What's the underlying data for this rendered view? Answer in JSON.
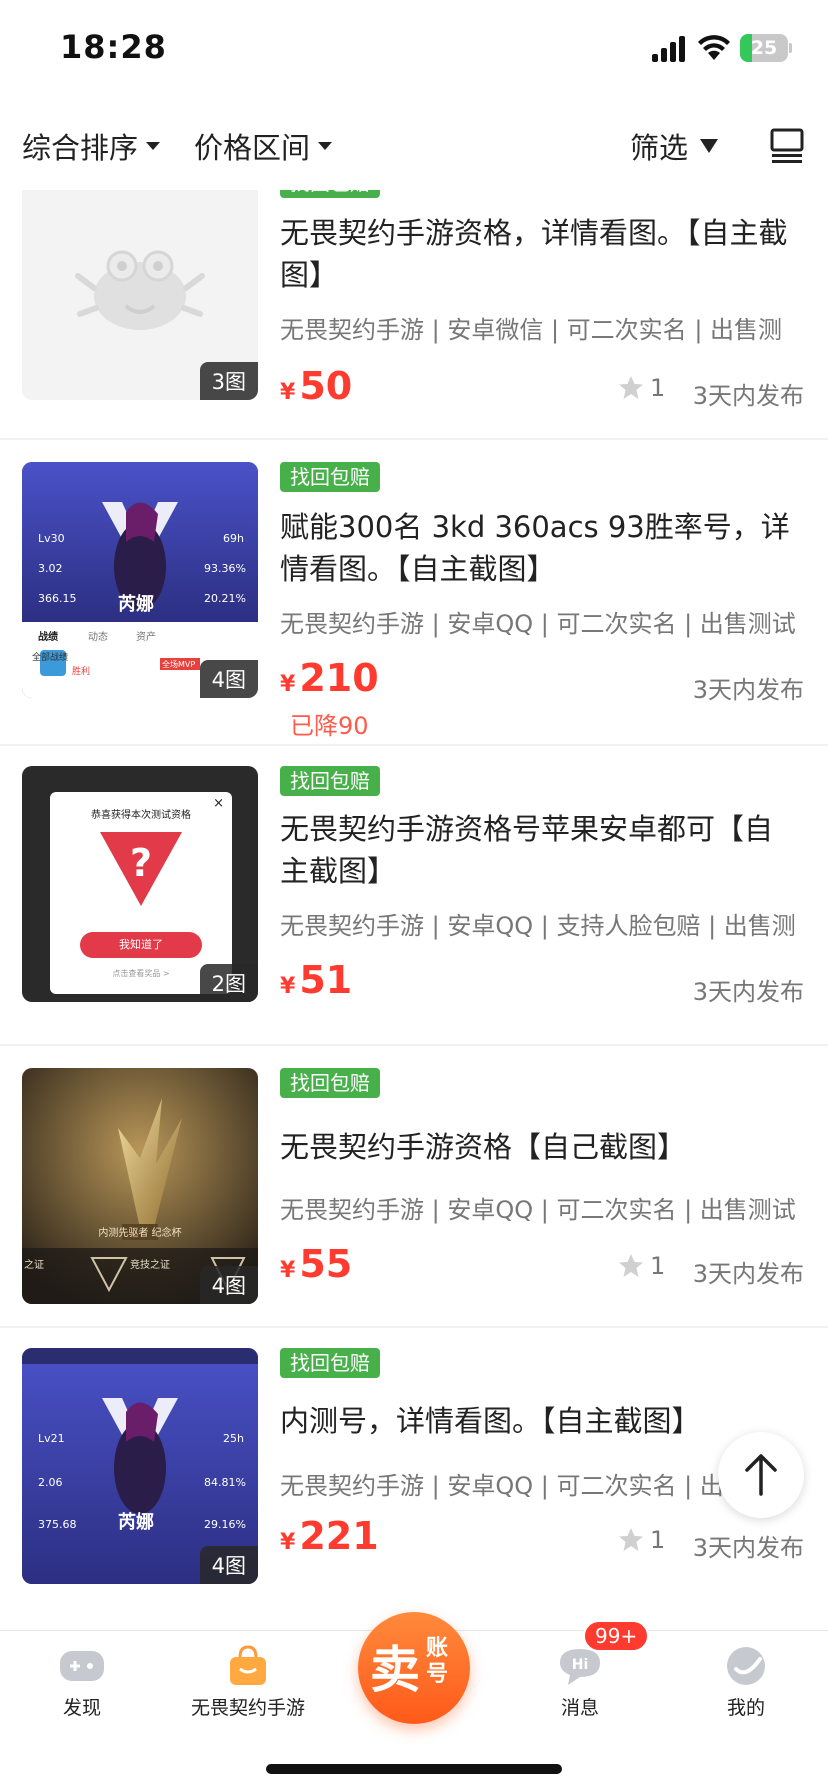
{
  "status": {
    "time": "18:28",
    "battery": "25",
    "battery_level": 0.25
  },
  "filter": {
    "sort_label": "综合排序",
    "price_label": "价格区间",
    "filter_label": "筛选"
  },
  "items": [
    {
      "badge": "找回包赔",
      "title": "无畏契约手游资格，详情看图。【自主截图】",
      "meta": "无畏契约手游 | 安卓微信 | 可二次实名 | 出售测",
      "price_symbol": "¥",
      "price": "50",
      "fav": "1",
      "posted": "3天内发布",
      "img_count": "3图"
    },
    {
      "badge": "找回包赔",
      "title": "赋能300名 3kd 360acs 93胜率号，详情看图。【自主截图】",
      "meta": "无畏契约手游 | 安卓QQ | 可二次实名 | 出售测试",
      "price_symbol": "¥",
      "price": "210",
      "reduced": "已降90",
      "posted": "3天内发布",
      "img_count": "4图",
      "thumb": {
        "lv": "Lv30",
        "kda": "3.02",
        "acs": "366.15",
        "hours": "69h",
        "winrate": "93.36%",
        "hs": "20.21%",
        "agent": "芮娜",
        "tab1": "战绩",
        "tab2": "动态",
        "tab3": "资产",
        "all": "全部战绩",
        "result": "胜利",
        "mvp": "全场MVP"
      }
    },
    {
      "badge": "找回包赔",
      "title": "无畏契约手游资格号苹果安卓都可【自主截图】",
      "meta": "无畏契约手游 | 安卓QQ | 支持人脸包赔 | 出售测",
      "price_symbol": "¥",
      "price": "51",
      "posted": "3天内发布",
      "img_count": "2图",
      "thumb": {
        "banner": "恭喜获得本次测试资格",
        "button": "我知道了",
        "link": "点击查看奖品 >"
      }
    },
    {
      "badge": "找回包赔",
      "title": "无畏契约手游资格【自己截图】",
      "meta": "无畏契约手游 | 安卓QQ | 可二次实名 | 出售测试",
      "price_symbol": "¥",
      "price": "55",
      "fav": "1",
      "posted": "3天内发布",
      "img_count": "4图",
      "thumb": {
        "caption": "内测先驱者 纪念杯",
        "left": "之证",
        "mid": "竞技之证"
      }
    },
    {
      "badge": "找回包赔",
      "title": "内测号，详情看图。【自主截图】",
      "meta": "无畏契约手游 | 安卓QQ | 可二次实名 | 出售测试",
      "price_symbol": "¥",
      "price": "221",
      "fav": "1",
      "posted": "3天内发布",
      "img_count": "4图",
      "thumb": {
        "lv": "Lv21",
        "kda": "2.06",
        "acs": "375.68",
        "hours": "25h",
        "winrate": "84.81%",
        "hs": "29.16%",
        "agent": "芮娜"
      }
    }
  ],
  "tabs": {
    "discover": "发现",
    "game": "无畏契约手游",
    "sell_big": "卖",
    "sell_small": "账号",
    "messages": "消息",
    "messages_badge": "99+",
    "mine": "我的"
  },
  "colors": {
    "accent": "#ff3b30",
    "badge_green": "#47b04b",
    "sell_orange": "#ff6a22"
  }
}
